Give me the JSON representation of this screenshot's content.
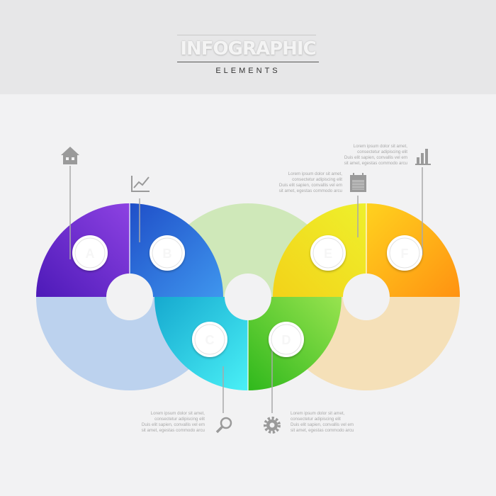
{
  "header": {
    "title": "INFOGRAPHIC",
    "subtitle": "ELEMENTS"
  },
  "segments": [
    {
      "letter": "A",
      "icon": "home-icon",
      "color_start": "#5b1fc4",
      "color_end": "#8a3ee0"
    },
    {
      "letter": "B",
      "icon": "line-chart-icon",
      "color_start": "#2f7ce6",
      "color_end": "#1f4fc8"
    },
    {
      "letter": "C",
      "icon": "search-icon",
      "color_start": "#1cb8d8",
      "color_end": "#46ecf5"
    },
    {
      "letter": "D",
      "icon": "gear-icon",
      "color_start": "#8fe04a",
      "color_end": "#3ac21e"
    },
    {
      "letter": "E",
      "icon": "calendar-icon",
      "color_start": "#e9e62a",
      "color_end": "#f9d315"
    },
    {
      "letter": "F",
      "icon": "bar-chart-icon",
      "color_start": "#ffc21a",
      "color_end": "#ff9c12"
    }
  ],
  "text_blocks": {
    "top_right": [
      "Lorem ipsum dolor sit amet,",
      "consectetur adipiscing elit",
      "Duis elit sapien, convallis vel em",
      "sit amet, egestas commodo arcu"
    ],
    "top_middle": [
      "Lorem ipsum dolor sit amet,",
      "consectetur adipiscing elit",
      "Duis elit sapien, convallis vel em",
      "sit amet, egestas commodo arcu"
    ],
    "bottom_left": [
      "Lorem ipsum dolor sit amet,",
      "consectetur adipiscing elit",
      "Duis elit sapien, convallis vel em",
      "sit amet, egestas commodo arcu"
    ],
    "bottom_right": [
      "Lorem ipsum dolor sit amet,",
      "consectetur adipiscing elit",
      "Duis elit sapien, convallis vel em",
      "sit amet, egestas commodo arcu"
    ]
  },
  "colors": {
    "background": "#f2f2f3",
    "header_band": "#e7e7e8",
    "ring_left_faded": "#bcd2ee",
    "ring_mid_faded": "#cfe8b9",
    "ring_right_faded": "#f5e0b8",
    "icon_gray": "#9a9a9a"
  }
}
